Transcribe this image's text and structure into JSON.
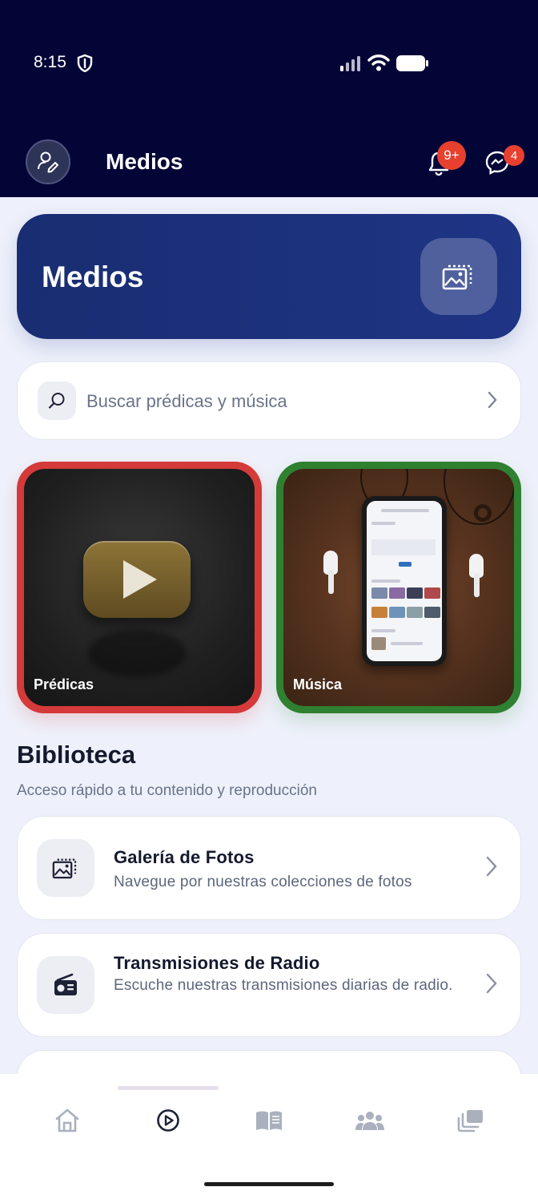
{
  "status_bar": {
    "time": "8:15"
  },
  "app_bar": {
    "title": "Medios",
    "notifications_badge": "9+",
    "messages_badge": "4"
  },
  "hero": {
    "title": "Medios"
  },
  "search": {
    "placeholder": "Buscar prédicas y música"
  },
  "tiles": [
    {
      "label": "Prédicas",
      "border_color": "#d43a3a"
    },
    {
      "label": "Música",
      "border_color": "#2f8030"
    }
  ],
  "library": {
    "title": "Biblioteca",
    "subtitle": "Acceso rápido a tu contenido y reproducción",
    "items": [
      {
        "title": "Galería de Fotos",
        "description": "Navegue por nuestras colecciones de fotos",
        "icon": "photo-gallery-icon"
      },
      {
        "title": "Transmisiones de Radio",
        "description": "Escuche nuestras transmisiones diarias de radio.",
        "icon": "radio-icon"
      }
    ]
  },
  "bottom_nav": {
    "items": [
      {
        "icon": "home-icon",
        "active": false
      },
      {
        "icon": "play-circle-icon",
        "active": true
      },
      {
        "icon": "book-icon",
        "active": false
      },
      {
        "icon": "group-icon",
        "active": false
      },
      {
        "icon": "collections-icon",
        "active": false
      }
    ]
  },
  "colors": {
    "header_bg": "#030537",
    "hero_bg": "#1f3585",
    "page_bg": "#eef1fb",
    "badge": "#e8402f"
  }
}
